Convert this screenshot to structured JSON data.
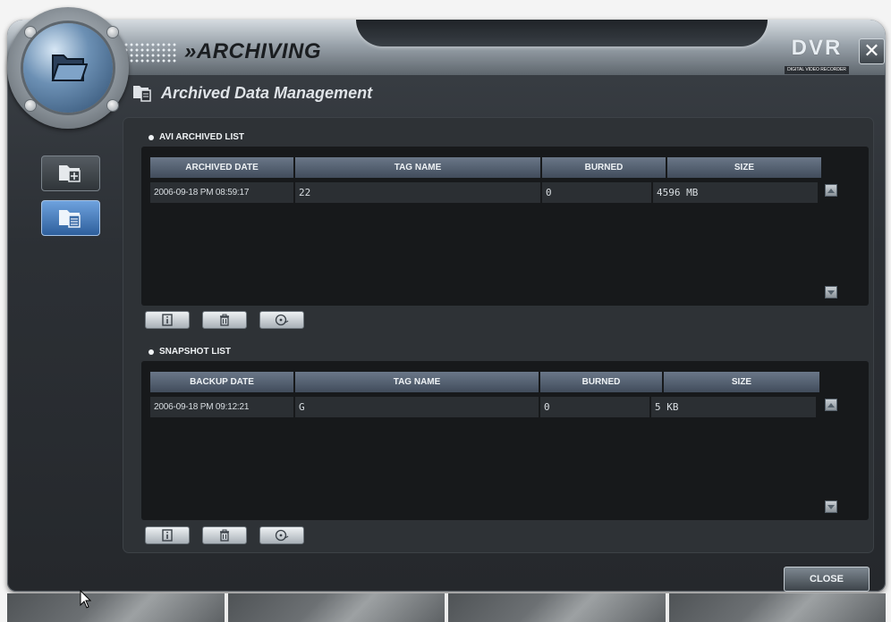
{
  "app": {
    "title": "ARCHIVING",
    "logo": "DVR",
    "logo_sub": "DIGITAL VIDEO RECORDER",
    "close_symbol": "✕"
  },
  "page": {
    "title": "Archived Data Management"
  },
  "sidebar": {
    "items": [
      {
        "icon": "folder-add-icon",
        "active": false
      },
      {
        "icon": "folder-document-icon",
        "active": true
      }
    ]
  },
  "avi_list": {
    "label": "AVI ARCHIVED LIST",
    "columns": [
      "ARCHIVED DATE",
      "TAG NAME",
      "BURNED",
      "SIZE"
    ],
    "rows": [
      [
        "2006-09-18  PM  08:59:17",
        "22",
        "0",
        "4596  MB"
      ]
    ]
  },
  "snapshot_list": {
    "label": "SNAPSHOT LIST",
    "columns": [
      "BACKUP DATE",
      "TAG NAME",
      "BURNED",
      "SIZE"
    ],
    "rows": [
      [
        "2006-09-18  PM  09:12:21",
        "G",
        "0",
        "5  KB"
      ]
    ]
  },
  "toolbar_icons": [
    "info-icon",
    "trash-icon",
    "disc-burn-icon"
  ],
  "footer": {
    "close_label": "CLOSE"
  },
  "colors": {
    "accent_blue": "#3f74b8",
    "header_blue": "#55627a"
  }
}
